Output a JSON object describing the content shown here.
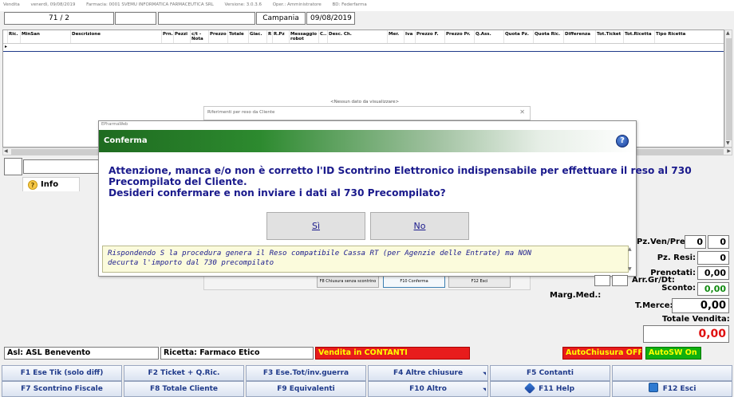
{
  "window": {
    "title_items": [
      "Vendita",
      "venerdì, 09/08/2019",
      "Farmacia: 0001 SVEMU INFORMATICA FARMACEUTICA SRL",
      "Versione: 3.0.3.6",
      "Oper.: Amministratore",
      "BD: Federfarma"
    ]
  },
  "top": {
    "counter": "71 / 2",
    "region": "Campania",
    "date": "09/08/2019"
  },
  "grid": {
    "columns": [
      "Ric.",
      "MinSan",
      "Descrizione",
      "Prn.",
      "Pezzi",
      "c/t - Nota",
      "Prezzo",
      "Totale",
      "Giac.",
      "R",
      "R.Pz",
      "Messaggio robot",
      "C..",
      "Desc. Ch.",
      "Mer.",
      "Iva",
      "Prezzo F.",
      "Prezzo Pr.",
      "Q.Ass.",
      "Quota Pz.",
      "Quota Ric.",
      "Differenza",
      "Tot.Ticket",
      "Tot.Ricetta",
      "Tipo Ricetta"
    ],
    "empty_message": "<Nessun dato da visualizzare>"
  },
  "info_tab": {
    "label": "Info"
  },
  "background_panel": {
    "title": "Riferimenti per reso da Cliente"
  },
  "background_buttons": {
    "f8": "F8 Chiusura senza scontrino",
    "f10": "F10 Conferma",
    "f12": "F12 Esci"
  },
  "dialog": {
    "app_name": "EPharmaWeb",
    "title": "Conferma",
    "message_lines": [
      "Attenzione, manca e/o non è corretto l'ID Scontrino Elettronico indispensabile per effettuare il reso al 730",
      "Precompilato del Cliente.",
      "Desideri confermare e non inviare i dati al 730 Precompilato?"
    ],
    "yes_label": "Sì",
    "no_label": "No",
    "note_lines": [
      "Rispondendo S la procedura genera il Reso compatibile Cassa RT (per Agenzie delle Entrate) ma NON",
      "decurta l'importo dal 730 precompilato"
    ]
  },
  "totals": {
    "pz_ven_pre_label": "Pz.Ven/Pre:",
    "pz_ven": "0",
    "pz_pre": "0",
    "pz_resi_label": "Pz. Resi:",
    "pz_resi": "0",
    "prenotati_label": "Prenotati:",
    "prenotati": "0,00",
    "sconto_label": "Sconto:",
    "sconto": "0,00",
    "arr_label": "Arr.Gr/Dt:",
    "marg_label": "Marg.Med.:",
    "tmerce_label": "T.Merce:",
    "tmerce": "0,00",
    "totale_vendita_label": "Totale Vendita:",
    "totale_vendita": "0,00"
  },
  "status": {
    "asl": "Asl: ASL Benevento",
    "ricetta": "Ricetta: Farmaco Etico",
    "vendita": "Vendita in CONTANTI",
    "autochiusura": "AutoChiusura OFF",
    "autosw": "AutoSW On"
  },
  "fkeys": {
    "f1": "F1 Ese Tik (solo diff)",
    "f2": "F2 Ticket + Q.Ric.",
    "f3": "F3 Ese.Tot/inv.guerra",
    "f4": "F4 Altre chiusure",
    "f5": "F5 Contanti",
    "f7": "F7 Scontrino Fiscale",
    "f8": "F8 Totale Cliente",
    "f9": "F9 Equivalenti",
    "f10": "F10 Altro",
    "f11": "F11 Help",
    "f12": "F12 Esci"
  },
  "colors": {
    "dialog_header_green": "#2d8a2f",
    "dialog_text_blue": "#1a1a8c",
    "status_red": "#e81c1c",
    "status_yellow_text": "#ffff00",
    "autosw_green": "#10b010",
    "total_red": "#e01010",
    "positive_green": "#108a10"
  },
  "icons": [
    "info-icon",
    "help-icon",
    "f11-help-icon",
    "f12-exit-icon",
    "scroll-up-icon",
    "scroll-down-icon",
    "scroll-left-icon",
    "scroll-right-icon"
  ]
}
